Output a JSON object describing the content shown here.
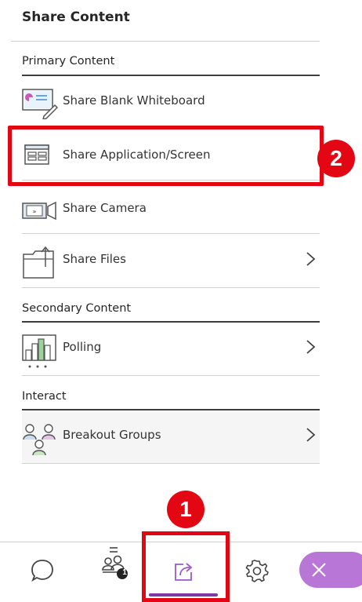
{
  "panel": {
    "title": "Share Content",
    "sections": {
      "primary": "Primary Content",
      "secondary": "Secondary Content",
      "interact": "Interact"
    },
    "items": {
      "whiteboard": "Share Blank Whiteboard",
      "application": "Share Application/Screen",
      "camera": "Share Camera",
      "files": "Share Files",
      "polling": "Polling",
      "breakout": "Breakout Groups"
    }
  },
  "annotations": {
    "step1": "1",
    "step2": "2"
  },
  "toolbar": {
    "participants_badge": "1",
    "icons": [
      "chat-icon",
      "participants-icon",
      "share-content-icon",
      "settings-icon",
      "close-icon"
    ]
  },
  "colors": {
    "accent_purple": "#7b3aa8",
    "close_pill": "#b877d6",
    "annotation_red": "#e30613"
  }
}
